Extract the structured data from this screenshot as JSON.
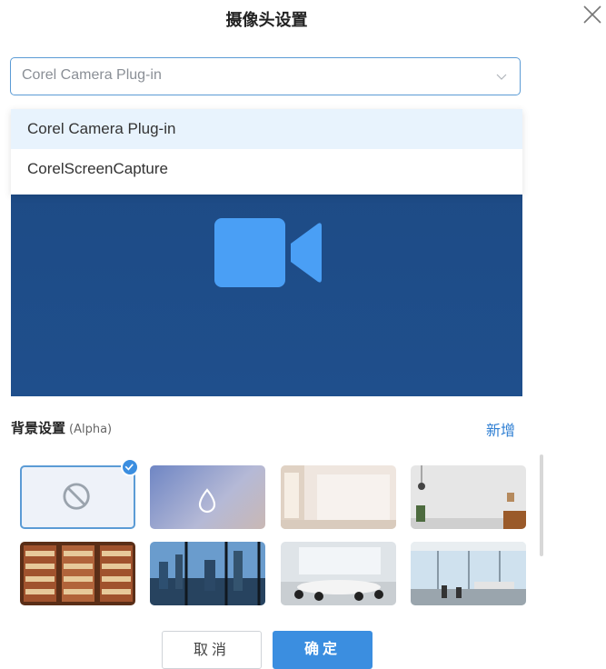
{
  "dialog": {
    "title": "摄像头设置",
    "close_icon": "close-icon"
  },
  "camera_select": {
    "value": "Corel Camera Plug-in",
    "options": [
      "Corel Camera Plug-in",
      "CorelScreenCapture"
    ],
    "selected_index": 0
  },
  "preview": {
    "icon": "video-camera-icon",
    "background_color": "#1e4b86",
    "icon_color": "#4a9ff5"
  },
  "background": {
    "label": "背景设置",
    "label_suffix": "(Alpha)",
    "add_label": "新增",
    "accent_color": "#2f7fd3",
    "items": [
      {
        "name": "none",
        "icon": "no-background-icon",
        "selected": true
      },
      {
        "name": "blur",
        "icon": "blur-drop-icon"
      },
      {
        "name": "white-room"
      },
      {
        "name": "gray-wall-room"
      },
      {
        "name": "bookshelf"
      },
      {
        "name": "city-skyline"
      },
      {
        "name": "meeting-room"
      },
      {
        "name": "office-window"
      }
    ]
  },
  "buttons": {
    "cancel": "取消",
    "confirm": "确定",
    "confirm_color": "#3b8ee0"
  }
}
